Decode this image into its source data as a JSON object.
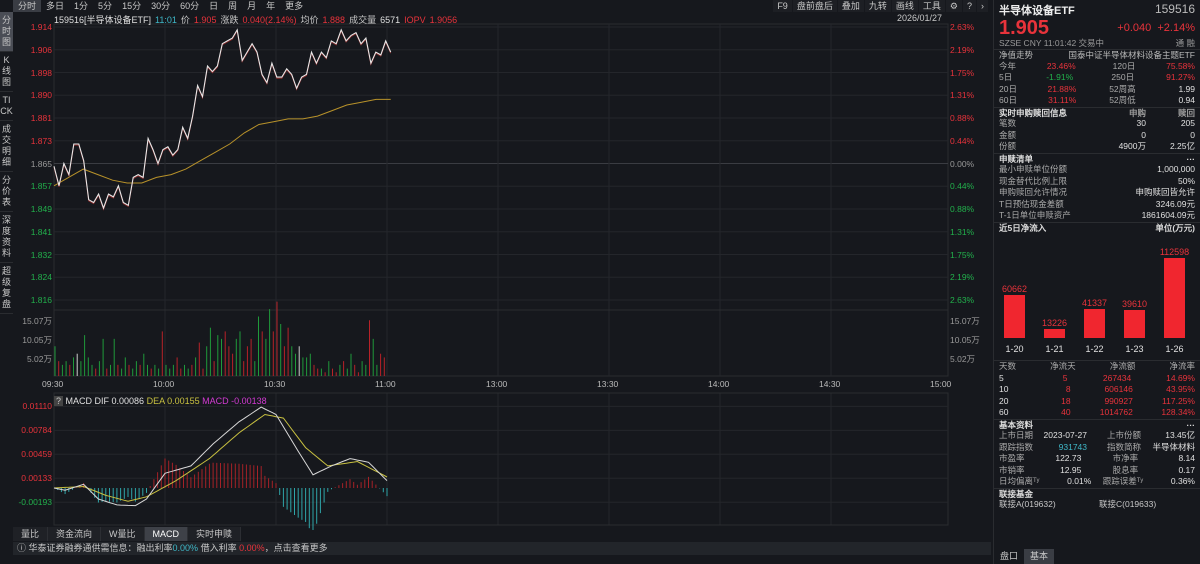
{
  "toolbar": {
    "periods": [
      "分时",
      "多日",
      "1分",
      "5分",
      "15分",
      "30分",
      "60分",
      "日",
      "周",
      "月",
      "年",
      "更多"
    ],
    "tools": [
      "F9",
      "盘前盘后",
      "叠加",
      "九转",
      "画线",
      "工具"
    ],
    "date": "2026/01/27"
  },
  "sidebar": [
    "分时图",
    "K线图",
    "TICK",
    "成交明细",
    "分价表",
    "深度资料",
    "超级复盘"
  ],
  "info": {
    "code_name": "159516[半导体设备ETF]",
    "time": "11:01",
    "price_label": "价",
    "price": "1.905",
    "change_label": "涨跌",
    "change": "0.040(2.14%)",
    "avg_label": "均价",
    "avg": "1.888",
    "vol_label": "成交量",
    "vol": "6571",
    "iopv_label": "IOPV",
    "iopv": "1.9056"
  },
  "price_axis": {
    "left": [
      "1.914",
      "1.906",
      "1.898",
      "1.890",
      "1.881",
      "1.873",
      "1.865",
      "1.857",
      "1.849",
      "1.841",
      "1.832",
      "1.824",
      "1.816"
    ],
    "right": [
      "2.63%",
      "2.19%",
      "1.75%",
      "1.31%",
      "0.88%",
      "0.44%",
      "0.00%",
      "0.44%",
      "0.88%",
      "1.31%",
      "1.75%",
      "2.19%",
      "2.63%"
    ],
    "prev_close": 1.865,
    "range": [
      1.816,
      1.914
    ]
  },
  "volume_axis": [
    "15.07万",
    "10.05万",
    "5.02万"
  ],
  "time_axis": [
    "09:30",
    "10:00",
    "10:30",
    "11:00",
    "13:00",
    "13:30",
    "14:00",
    "14:30",
    "15:00"
  ],
  "chart_data": [
    {
      "type": "line",
      "name": "intraday",
      "price": [
        1.864,
        1.857,
        1.865,
        1.861,
        1.872,
        1.872,
        1.866,
        1.852,
        1.851,
        1.854,
        1.849,
        1.854,
        1.853,
        1.857,
        1.851,
        1.85,
        1.86,
        1.861,
        1.86,
        1.874,
        1.87,
        1.865,
        1.87,
        1.871,
        1.868,
        1.87,
        1.878,
        1.874,
        1.882,
        1.893,
        1.889,
        1.9,
        1.898,
        1.9,
        1.908,
        1.909,
        1.91,
        1.913,
        1.902,
        1.905,
        1.908,
        1.905,
        1.897,
        1.894,
        1.901,
        1.896,
        1.896,
        1.899,
        1.897,
        1.892,
        1.896,
        1.897,
        1.905,
        1.901,
        1.905,
        1.903,
        1.909,
        1.908,
        1.913,
        1.909,
        1.911,
        1.912,
        1.908,
        1.91,
        1.901,
        1.905,
        1.904,
        1.909,
        1.905
      ],
      "avg": [
        1.857,
        1.86,
        1.863,
        1.861,
        1.859,
        1.858,
        1.858,
        1.86,
        1.861,
        1.863,
        1.866,
        1.869,
        1.872,
        1.876,
        1.879,
        1.88,
        1.881,
        1.881,
        1.882,
        1.884,
        1.886,
        1.887,
        1.888,
        1.888
      ],
      "volume_wan": [
        8,
        4,
        3,
        4,
        3,
        5,
        6,
        4,
        11,
        5,
        3,
        2,
        4,
        10,
        2,
        3,
        10,
        3,
        2,
        5,
        3,
        2,
        4,
        3,
        6,
        3,
        2,
        3,
        2,
        12,
        3,
        2,
        3,
        5,
        2,
        3,
        2,
        3,
        5,
        9,
        2,
        8,
        13,
        4,
        11,
        10,
        12,
        8,
        6,
        10,
        12,
        4,
        8,
        10,
        4,
        16,
        12,
        10,
        18,
        12,
        20,
        14,
        8,
        13,
        8,
        6,
        8,
        5,
        5,
        6,
        3,
        2,
        2,
        1,
        4,
        2,
        1,
        3,
        4,
        2,
        6,
        3,
        1,
        4,
        3,
        15,
        10,
        3,
        6,
        5
      ],
      "volume_dir": "duddudwdddduddudduddudduddudduddduudduduuddudduuudduuuddudduuduuddwddduududuududduuddudduuu"
    },
    {
      "type": "line",
      "name": "MACD",
      "yticks": [
        "0.01110",
        "0.00784",
        "0.00459",
        "0.00133",
        "-0.00193"
      ],
      "dif": [
        [
          0,
          0
        ],
        [
          3,
          -0.0003
        ],
        [
          8,
          0.0005
        ],
        [
          12,
          -0.0015
        ],
        [
          17,
          -0.0023
        ],
        [
          22,
          -0.0024
        ],
        [
          25,
          -0.0015
        ],
        [
          30,
          0.002
        ],
        [
          37,
          0.003
        ],
        [
          43,
          0.006
        ],
        [
          50,
          0.009
        ],
        [
          56,
          0.011
        ],
        [
          60,
          0.01
        ],
        [
          66,
          0.005
        ],
        [
          70,
          0.0018
        ],
        [
          75,
          0.003
        ],
        [
          80,
          0.004
        ],
        [
          85,
          0.0035
        ],
        [
          90,
          0.001
        ]
      ],
      "dea": [
        [
          0,
          0
        ],
        [
          8,
          0.0002
        ],
        [
          14,
          -0.001
        ],
        [
          20,
          -0.0018
        ],
        [
          25,
          -0.0012
        ],
        [
          33,
          0.001
        ],
        [
          42,
          0.004
        ],
        [
          50,
          0.0075
        ],
        [
          57,
          0.01
        ],
        [
          62,
          0.0095
        ],
        [
          68,
          0.0055
        ],
        [
          74,
          0.003
        ],
        [
          82,
          0.0036
        ],
        [
          90,
          0.0015
        ]
      ]
    }
  ],
  "macd": {
    "help": "?",
    "dif_label": "MACD DIF 0.00086",
    "dea_label": "DEA 0.00155",
    "macd_label": "MACD -0.00138"
  },
  "bottom_tabs": [
    "量比",
    "资金流向",
    "W量比",
    "MACD",
    "实时申赎"
  ],
  "notice": {
    "text": "华泰证券融券通供需信息：融出利率",
    "rate1": "0.00%",
    "mid": "借入利率",
    "rate2": "0.00%",
    "tail": "，点击查看更多"
  },
  "quote": {
    "name": "半导体设备ETF",
    "code": "159516",
    "price": "1.905",
    "change": "+0.040",
    "pct": "+2.14%",
    "meta": "SZSE  CNY  11:01:42  交易中",
    "flags": "通 融"
  },
  "nav": {
    "title": "净值走势",
    "index": "国泰中证半导体材料设备主题ETF",
    "rows": [
      [
        "今年",
        "23.46%",
        "120日",
        "75.58%"
      ],
      [
        "5日",
        "-1.91%",
        "250日",
        "91.27%"
      ],
      [
        "20日",
        "21.88%",
        "52周高",
        "1.99"
      ],
      [
        "60日",
        "31.11%",
        "52周低",
        "0.94"
      ]
    ]
  },
  "subs": {
    "title": "实时申购赎回信息",
    "h1": "申购",
    "h2": "赎回",
    "rows": [
      [
        "笔数",
        "30",
        "205"
      ],
      [
        "金额",
        "0",
        "0"
      ],
      [
        "份额",
        "4900万",
        "2.25亿"
      ]
    ]
  },
  "list": {
    "title": "申赎清单",
    "more": "···",
    "rows": [
      [
        "最小申赎单位份额",
        "1,000,000"
      ],
      [
        "现金替代比例上限",
        "50%"
      ],
      [
        "申购赎回允许情况",
        "申购赎回皆允许"
      ],
      [
        "T日预估现金差额",
        "3246.09元"
      ],
      [
        "T-1日单位申赎资产",
        "1861604.09元"
      ]
    ]
  },
  "flow": {
    "title": "近5日净流入",
    "unit": "单位(万元)",
    "dates": [
      "1-20",
      "1-21",
      "1-22",
      "1-23",
      "1-26"
    ],
    "values": [
      60662,
      13226,
      41337,
      39610,
      112598
    ]
  },
  "flowtable": {
    "headers": [
      "天数",
      "净流天",
      "净流额",
      "净流率"
    ],
    "rows": [
      [
        "5",
        "5",
        "267434",
        "14.69%"
      ],
      [
        "10",
        "8",
        "606146",
        "43.95%"
      ],
      [
        "20",
        "18",
        "990927",
        "117.25%"
      ],
      [
        "60",
        "40",
        "1014762",
        "128.34%"
      ]
    ]
  },
  "basic": {
    "title": "基本资料",
    "more": "···",
    "rows": [
      [
        "上市日期",
        "2023-07-27",
        "上市份额",
        "13.45亿"
      ],
      [
        "跟踪指数",
        "931743",
        "指数简称",
        "半导体材料"
      ],
      [
        "市盈率",
        "122.73",
        "市净率",
        "8.14"
      ],
      [
        "市销率",
        "12.95",
        "股息率",
        "0.17"
      ],
      [
        "日均偏离ᵀʸ",
        "0.01%",
        "跟踪误差ᵀʸ",
        "0.36%"
      ]
    ]
  },
  "linked": {
    "title": "联接基金",
    "a": "联接A(019632)",
    "c": "联接C(019633)"
  },
  "rp_tabs": [
    "盘口",
    "基本"
  ],
  "colors": {
    "up": "#e8333b",
    "down": "#22b14c",
    "price_line": "#e8e8e8",
    "avg_line": "#b8922a",
    "dea": "#c8c040",
    "hist_down": "#2fa5a8"
  }
}
